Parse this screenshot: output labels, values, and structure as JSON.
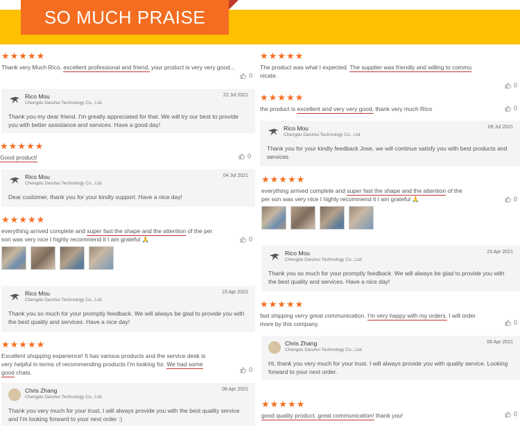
{
  "banner": {
    "title": "SO MUCH PRAISE"
  },
  "stars": "★★★★★",
  "left": {
    "r1": {
      "text_a": "Thank very Much Rico.",
      "text_hl": "excellent professional and friend,",
      "text_b": " your product is very very good...",
      "likes": "0"
    },
    "reply1": {
      "name": "Rico Mou",
      "company": "Chengdu Daruhui Technology Co., Ltd.",
      "date": "22 Jul 2021",
      "body": "Thank you my dear friend. I'm greatly appreciated for that. We will try our best to provide you with better assistance and services. Have a good day!"
    },
    "r2": {
      "text_hl": "Good product!",
      "likes": "0"
    },
    "reply2": {
      "name": "Rico Mou",
      "company": "Chengdu Daruhui Technology Co., Ltd.",
      "date": "04 Jul 2021",
      "body": "Dear customer, thank you for your kindly support. Have a nice day!"
    },
    "r3": {
      "text_a": "everything arrived complete and ",
      "text_hl": "super fast the shape and the attention",
      "text_b": " of the per son was very nice I highly recommend it I am grateful 🙏",
      "likes": "0"
    },
    "reply3": {
      "name": "Rico Mou",
      "company": "Chengdu Daruhui Technology Co., Ltd.",
      "date": "23 Apr 2021",
      "body": "Thank you so much for your promptly feedback. We will always be glad to provide you with the best quality and services. Have a nice day!"
    },
    "r4": {
      "text_a": "Excellent shopping experience! It has various products and the service desk is very helpful in terms of recommending products I'm looking for. ",
      "text_hl": "We had some good",
      "text_b": " chats.",
      "likes": "0"
    },
    "reply4": {
      "name": "Chris Zhang",
      "company": "Chengdu Daruhui Technology Co., Ltd.",
      "date": "06 Apr 2021",
      "body": "Thank you very much for your trust, I will always provide you with the best quality service and I'm looking forward to your next order :)"
    }
  },
  "right": {
    "r1": {
      "text_a": "The product was what I expected. ",
      "text_hl": "The supplier was friendly and willing to commu",
      "text_b": " nicate.",
      "likes": "0"
    },
    "r2": {
      "text_a": "the product is ",
      "text_hl": "excellent and very very good,",
      "text_b": " thank very much Rico",
      "likes": "0"
    },
    "reply1": {
      "name": "Rico Mou",
      "company": "Chengdu Daruhui Technology Co., Ltd.",
      "date": "09 Jul 2021",
      "body": "Thank you for your kindly feedback Jose, we will continue satisfy you with best products and services"
    },
    "r3": {
      "text_a": "everything arrived complete and ",
      "text_hl": "super fast the shape and the attention",
      "text_b": " of the per son was very nice I highly recommend it I am grateful 🙏",
      "likes": "0"
    },
    "reply2": {
      "name": "Rico Mou",
      "company": "Chengdu Daruhui Technology Co., Ltd.",
      "date": "23 Apr 2021",
      "body": "Thank you so much for your promptly feedback. We will always be glad to provide you with the best quality and services. Have a nice day!"
    },
    "r4": {
      "text_a": "fast shipping verry great communication. ",
      "text_hl": "I'm very happy with my orders.",
      "text_b": " I will order more by this company.",
      "likes": "0"
    },
    "reply3": {
      "name": "Chris Zhang",
      "company": "Chengdu Daruhui Technology Co., Ltd.",
      "date": "06 Apr 2021",
      "body": "Hi, thank you very much for your trust. I will always provide you with quality service. Looking forward to your next order."
    },
    "r5": {
      "text_hl": "good quality product. great communication!",
      "text_b": " thank you!",
      "likes": "0"
    }
  },
  "colors": {
    "accent": "#f46d20",
    "banner_strip": "#ffc000",
    "underline": "#c0392b"
  }
}
